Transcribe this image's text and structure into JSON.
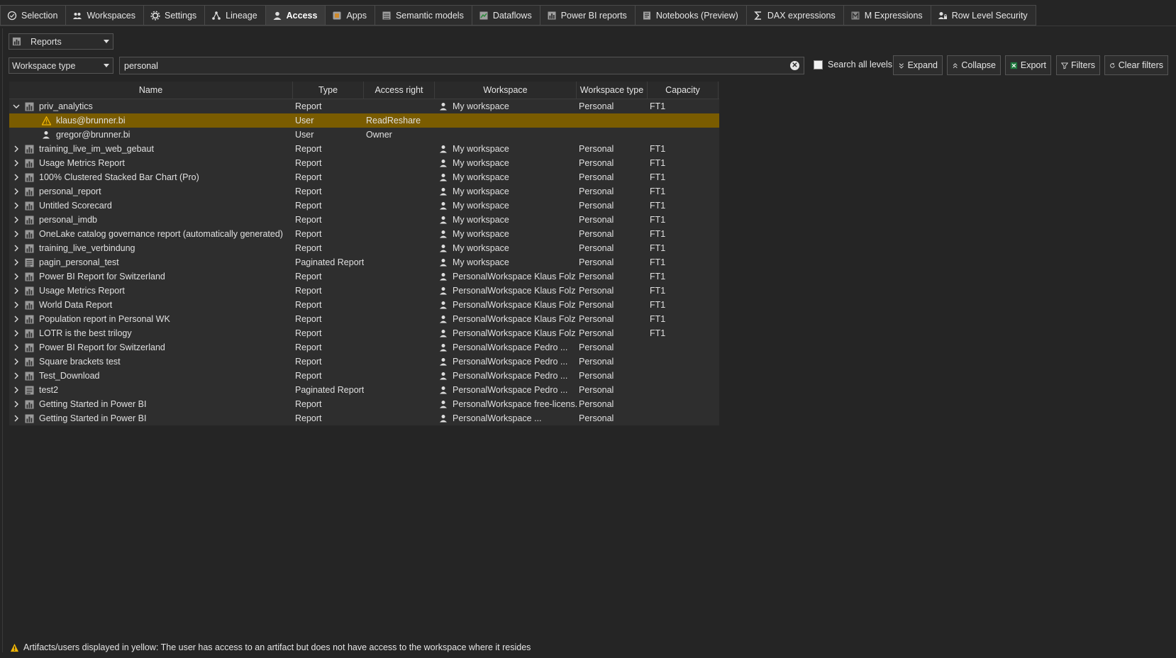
{
  "tabs": [
    {
      "label": "Selection",
      "icon": "check-circle-icon",
      "active": false
    },
    {
      "label": "Workspaces",
      "icon": "users-icon",
      "active": false
    },
    {
      "label": "Settings",
      "icon": "gear-icon",
      "active": false
    },
    {
      "label": "Lineage",
      "icon": "lineage-icon",
      "active": false
    },
    {
      "label": "Access",
      "icon": "user-icon",
      "active": true
    },
    {
      "label": "Apps",
      "icon": "app-icon",
      "active": false
    },
    {
      "label": "Semantic models",
      "icon": "model-icon",
      "active": false
    },
    {
      "label": "Dataflows",
      "icon": "dataflow-icon",
      "active": false
    },
    {
      "label": "Power BI reports",
      "icon": "report-icon",
      "active": false
    },
    {
      "label": "Notebooks (Preview)",
      "icon": "notebook-icon",
      "active": false
    },
    {
      "label": "DAX expressions",
      "icon": "sigma-icon",
      "active": false
    },
    {
      "label": "M Expressions",
      "icon": "m-expression-icon",
      "active": false
    },
    {
      "label": "Row Level Security",
      "icon": "rls-icon",
      "active": false
    }
  ],
  "artifact_select": {
    "value": "Reports"
  },
  "filter_select": {
    "value": "Workspace type"
  },
  "search": {
    "value": "personal"
  },
  "search_all_levels": {
    "label": "Search all levels",
    "checked": false
  },
  "buttons": {
    "expand": "Expand",
    "collapse": "Collapse",
    "export": "Export",
    "filters": "Filters",
    "clear_filters": "Clear filters"
  },
  "columns": [
    "Name",
    "Type",
    "Access right",
    "Workspace",
    "Workspace type",
    "Capacity"
  ],
  "rows": [
    {
      "name": "priv_analytics",
      "type": "Report",
      "access": "",
      "workspace": "My workspace",
      "wstype": "Personal",
      "capacity": "FT1",
      "expanded": true,
      "kind": "report"
    },
    {
      "name": "klaus@brunner.bi",
      "type": "User",
      "access": "ReadReshare",
      "workspace": "",
      "wstype": "",
      "capacity": "",
      "child": true,
      "warning": true
    },
    {
      "name": "gregor@brunner.bi",
      "type": "User",
      "access": "Owner",
      "workspace": "",
      "wstype": "",
      "capacity": "",
      "child": true
    },
    {
      "name": "training_live_im_web_gebaut",
      "type": "Report",
      "access": "",
      "workspace": "My workspace",
      "wstype": "Personal",
      "capacity": "FT1",
      "kind": "report"
    },
    {
      "name": "Usage Metrics Report",
      "type": "Report",
      "access": "",
      "workspace": "My workspace",
      "wstype": "Personal",
      "capacity": "FT1",
      "kind": "report"
    },
    {
      "name": "100% Clustered Stacked Bar Chart (Pro)",
      "type": "Report",
      "access": "",
      "workspace": "My workspace",
      "wstype": "Personal",
      "capacity": "FT1",
      "kind": "report"
    },
    {
      "name": "personal_report",
      "type": "Report",
      "access": "",
      "workspace": "My workspace",
      "wstype": "Personal",
      "capacity": "FT1",
      "kind": "report"
    },
    {
      "name": "Untitled Scorecard",
      "type": "Report",
      "access": "",
      "workspace": "My workspace",
      "wstype": "Personal",
      "capacity": "FT1",
      "kind": "report"
    },
    {
      "name": "personal_imdb",
      "type": "Report",
      "access": "",
      "workspace": "My workspace",
      "wstype": "Personal",
      "capacity": "FT1",
      "kind": "report"
    },
    {
      "name": "OneLake catalog governance report (automatically generated)",
      "type": "Report",
      "access": "",
      "workspace": "My workspace",
      "wstype": "Personal",
      "capacity": "FT1",
      "kind": "report"
    },
    {
      "name": "training_live_verbindung",
      "type": "Report",
      "access": "",
      "workspace": "My workspace",
      "wstype": "Personal",
      "capacity": "FT1",
      "kind": "report"
    },
    {
      "name": "pagin_personal_test",
      "type": "Paginated Report",
      "access": "",
      "workspace": "My workspace",
      "wstype": "Personal",
      "capacity": "FT1",
      "kind": "paginated"
    },
    {
      "name": "Power BI Report for Switzerland",
      "type": "Report",
      "access": "",
      "workspace": "PersonalWorkspace Klaus Folz",
      "wstype": "Personal",
      "capacity": "FT1",
      "kind": "report"
    },
    {
      "name": "Usage Metrics Report",
      "type": "Report",
      "access": "",
      "workspace": "PersonalWorkspace Klaus Folz",
      "wstype": "Personal",
      "capacity": "FT1",
      "kind": "report"
    },
    {
      "name": "World Data Report",
      "type": "Report",
      "access": "",
      "workspace": "PersonalWorkspace Klaus Folz",
      "wstype": "Personal",
      "capacity": "FT1",
      "kind": "report"
    },
    {
      "name": "Population report in Personal WK",
      "type": "Report",
      "access": "",
      "workspace": "PersonalWorkspace Klaus Folz",
      "wstype": "Personal",
      "capacity": "FT1",
      "kind": "report"
    },
    {
      "name": "LOTR is the best trilogy",
      "type": "Report",
      "access": "",
      "workspace": "PersonalWorkspace Klaus Folz",
      "wstype": "Personal",
      "capacity": "FT1",
      "kind": "report"
    },
    {
      "name": "Power BI Report for Switzerland",
      "type": "Report",
      "access": "",
      "workspace": "PersonalWorkspace Pedro ...",
      "wstype": "Personal",
      "capacity": "",
      "kind": "report"
    },
    {
      "name": "Square brackets test",
      "type": "Report",
      "access": "",
      "workspace": "PersonalWorkspace Pedro ...",
      "wstype": "Personal",
      "capacity": "",
      "kind": "report"
    },
    {
      "name": "Test_Download",
      "type": "Report",
      "access": "",
      "workspace": "PersonalWorkspace Pedro ...",
      "wstype": "Personal",
      "capacity": "",
      "kind": "report"
    },
    {
      "name": "test2",
      "type": "Paginated Report",
      "access": "",
      "workspace": "PersonalWorkspace Pedro ...",
      "wstype": "Personal",
      "capacity": "",
      "kind": "paginated"
    },
    {
      "name": "Getting Started in Power BI",
      "type": "Report",
      "access": "",
      "workspace": "PersonalWorkspace free-licens...",
      "wstype": "Personal",
      "capacity": "",
      "kind": "report"
    },
    {
      "name": "Getting Started in Power BI",
      "type": "Report",
      "access": "",
      "workspace": "PersonalWorkspace ...",
      "wstype": "Personal",
      "capacity": "",
      "kind": "report"
    }
  ],
  "footer": {
    "text": "Artifacts/users displayed in yellow: The user has access to an artifact but does not have access to the workspace where it resides"
  },
  "colors": {
    "background": "#252525",
    "highlight": "#7a5c00",
    "warning": "#f2b705"
  }
}
